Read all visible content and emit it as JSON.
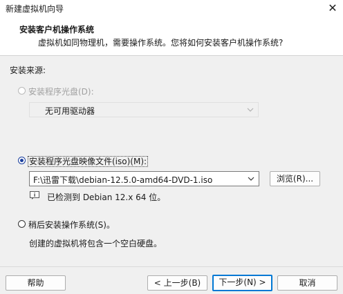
{
  "window": {
    "title": "新建虚拟机向导",
    "close_glyph": "✕"
  },
  "header": {
    "title": "安装客户机操作系统",
    "subtitle": "虚拟机如同物理机，需要操作系统。您将如何安装客户机操作系统?"
  },
  "install_source": {
    "label": "安装来源:",
    "options": [
      {
        "label": "安装程序光盘(D):",
        "selected": false,
        "enabled": false
      },
      {
        "label": "安装程序光盘映像文件(iso)(M):",
        "selected": true,
        "enabled": true
      },
      {
        "label": "稍后安装操作系统(S)。",
        "selected": false,
        "enabled": true
      }
    ],
    "disc_dropdown": {
      "value": "无可用驱动器"
    },
    "iso_path": {
      "value": "F:\\迅雷下载\\debian-12.5.0-amd64-DVD-1.iso"
    },
    "browse_label": "浏览(R)...",
    "detected_text": "已检测到 Debian 12.x 64 位。",
    "later_note": "创建的虚拟机将包含一个空白硬盘。"
  },
  "footer": {
    "help": "帮助",
    "back": "< 上一步(B)",
    "next": "下一步(N) >",
    "cancel": "取消"
  },
  "icons": {
    "close": "close-icon",
    "dropdown": "chevron-down-icon",
    "info": "info-icon"
  },
  "colors": {
    "accent": "#0078d4",
    "radio_selected": "#1a3f9e"
  }
}
